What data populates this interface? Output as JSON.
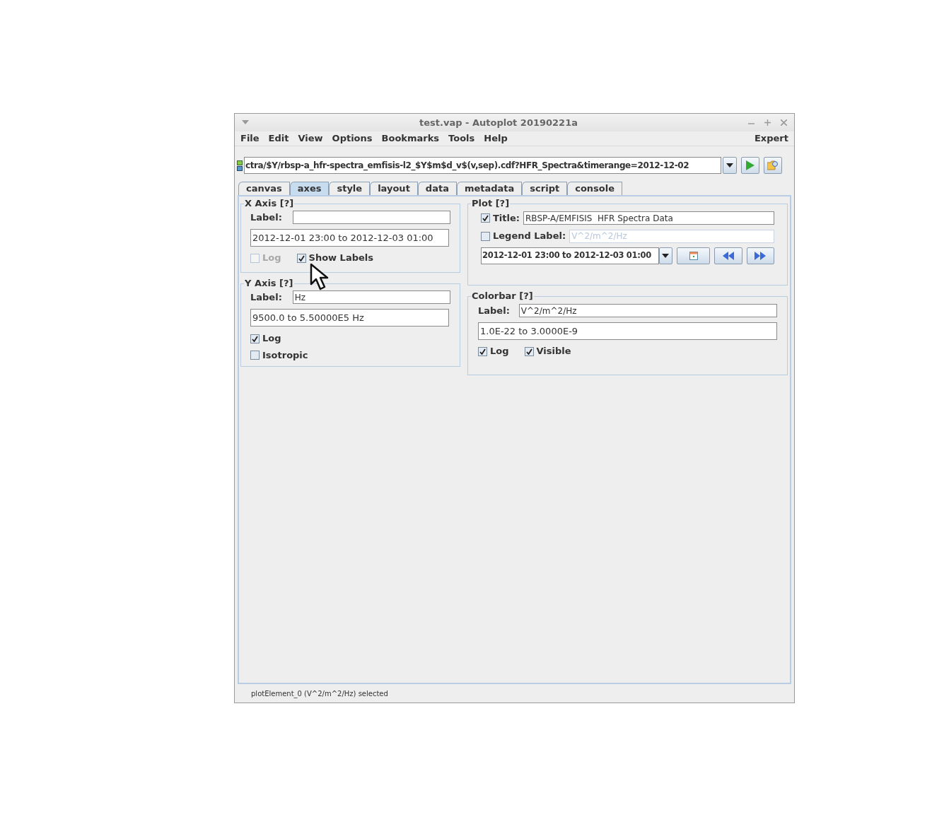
{
  "window": {
    "title": "test.vap - Autoplot 20190221a"
  },
  "menu": {
    "items": [
      "File",
      "Edit",
      "View",
      "Options",
      "Bookmarks",
      "Tools",
      "Help"
    ],
    "right": "Expert"
  },
  "address": {
    "value": "ctra/$Y/rbsp-a_hfr-spectra_emfisis-l2_$Y$m$d_v$(v,sep).cdf?HFR_Spectra&timerange=2012-12-02"
  },
  "tabs": [
    {
      "label": "canvas",
      "selected": false
    },
    {
      "label": "axes",
      "selected": true
    },
    {
      "label": "style",
      "selected": false
    },
    {
      "label": "layout",
      "selected": false
    },
    {
      "label": "data",
      "selected": false
    },
    {
      "label": "metadata",
      "selected": false
    },
    {
      "label": "script",
      "selected": false
    },
    {
      "label": "console",
      "selected": false
    }
  ],
  "x_axis": {
    "title": "X Axis [?]",
    "label": "Label:",
    "range": "2012-12-01 23:00 to 2012-12-03 01:00",
    "checkboxes": [
      {
        "label": "Log",
        "checked": false,
        "disabled": true
      },
      {
        "label": "Show Labels",
        "checked": true,
        "disabled": false
      }
    ]
  },
  "y_axis": {
    "title": "Y Axis [?]",
    "label": "Label:",
    "value": "Hz",
    "range": "9500.0 to 5.50000E5 Hz",
    "checkboxes": [
      {
        "label": "Log",
        "checked": true,
        "disabled": false
      },
      {
        "label": "Isotropic",
        "checked": false,
        "disabled": false
      }
    ]
  },
  "plot": {
    "title": "Plot [?]",
    "fields": [
      {
        "label": "Title:",
        "checked": true,
        "value": "RBSP-A/EMFISIS  HFR Spectra Data"
      },
      {
        "label": "Legend Label:",
        "checked": false,
        "value": "V^2/m^2/Hz"
      }
    ],
    "timerange": "2012-12-01 23:00 to 2012-12-03 01:00"
  },
  "colorbar": {
    "title": "Colorbar [?]",
    "label": "Label:",
    "value": "V^2/m^2/Hz",
    "range": "1.0E-22 to 3.0000E-9",
    "checkboxes": [
      {
        "label": "Log",
        "checked": true,
        "disabled": false
      },
      {
        "label": "Visible",
        "checked": true,
        "disabled": false
      }
    ]
  },
  "status_bar": "plotElement_0 (V^2/m^2/Hz) selected"
}
